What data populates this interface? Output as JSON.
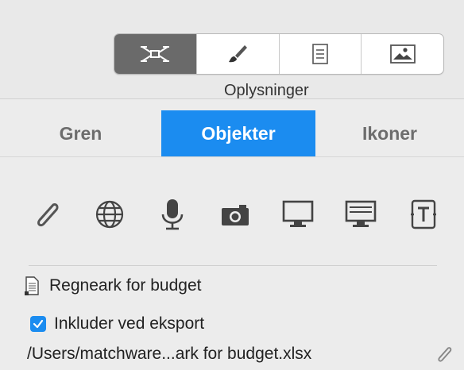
{
  "toolbar": {
    "caption": "Oplysninger",
    "buttons": [
      {
        "icon": "mindmap-icon",
        "active": true
      },
      {
        "icon": "brush-icon",
        "active": false
      },
      {
        "icon": "document-icon",
        "active": false
      },
      {
        "icon": "image-icon",
        "active": false
      }
    ]
  },
  "tabs": [
    {
      "label": "Gren",
      "active": false
    },
    {
      "label": "Objekter",
      "active": true
    },
    {
      "label": "Ikoner",
      "active": false
    }
  ],
  "object_icons": [
    "paperclip-icon",
    "globe-icon",
    "microphone-icon",
    "camera-icon",
    "monitor-icon",
    "presentation-icon",
    "text-box-icon"
  ],
  "attachment": {
    "name": "Regneark for budget",
    "include_label": "Inkluder ved eksport",
    "include_checked": true,
    "path": "/Users/matchware...ark for budget.xlsx"
  },
  "colors": {
    "accent": "#1b8cf0",
    "active_segment": "#6a6a6a",
    "panel_bg": "#ececec"
  }
}
